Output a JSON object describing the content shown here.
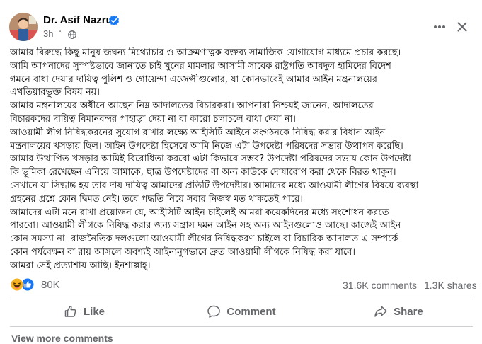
{
  "author": {
    "name": "Dr. Asif Nazrul",
    "time": "3h",
    "separator": "·",
    "verified": true,
    "verified_color": "#1877f2"
  },
  "post": {
    "lines": [
      "আমার বিরুদ্ধে কিছু মানুষ জঘন্য মিথ্যোচার ও আক্রমণাত্নক বক্তব্য সামাজিক যোগাযোগ মাধ্যমে প্রচার করছে।",
      "আমি আপনাদের সুস্পষ্টভাবে জানাতে চাই খুনের মামলার আসামী সাবেক রাষ্ট্রপতি আবদুল হামিদের বিদেশ",
      "গমনে বাধা দেয়ার দায়িত্ব পুলিশ ও গোয়েন্দা এজেন্সীগুলোর, যা কোনভাবেই আমার আইন মন্ত্রনালয়ের",
      "এখতিয়ারভুক্ত বিষয় নয়।",
      "আমার মন্ত্রনালয়ের অধীনে আছেন নিম্ন আদালতের বিচারকরা। আপনারা নিশ্চয়ই জানেন, আদালতের",
      "বিচারকদের দায়িত্ব বিমানবন্দর পাহাড়া দেয়া না বা কারো চলাচলে বাধা দেয়া না।",
      "আওয়ামী লীগ নিষিদ্ধকরনের সুযোগ রাখার লক্ষ্যে আইসিটি আইনে সংগঠনকে নিষিদ্ধ করার বিধান আইন",
      "মন্ত্রনালয়ের খসড়ায় ছিল। আইন উপদেষ্টা হিসেবে আমি নিজে এটা উপদেষ্টা পরিষদের সভায় উত্থাপন করেছি।",
      "আমার উত্থাপিত খসড়ার আমিই বিরোধিতা করবো এটা কিভাবে সম্ভব? উপদেষ্টা পরিষদের সভায় কোন উপদেষ্টা",
      "কি ভূমিকা রেখেছেন এনিয়ে আমাকে, ছাত্র উপদেষ্টাদের বা অন্য কাউকে দোষারোপ করা থেকে বিরত থাকুন।",
      "সেখানে যা সিদ্ধান্ত হয় তার দায় দায়িত্ব আমাদের প্রতিটি উপদেষ্টার। আমাদের মধ্যে আওয়ামী লীগের বিষয়ে ব্যবস্থা",
      "গ্রহনের প্রশ্নে কোন দ্বিমত নেই। তবে পদ্ধতি নিয়ে সবার নিজস্ব মত থাকতেই পারে।",
      "আমাদের এটা মনে রাখা প্রয়োজন যে, আইসিটি আইন চাইলেই আমরা কয়েকদিনের মধ্যে সংশোধন করতে",
      "পারবো। আওয়ামী লীগকে নিষিদ্ধ করার জন্য সন্ত্রাস দমন আইন সহ অন্য আইনগুলোও আছে। কাজেই আইন",
      "কোন সমস্যা না।  রাজনৈতিক দলগুলো আওয়ামী লীগের নিষিদ্ধকরণ চাইলে বা বিচারিক আদালত এ সম্পর্কে",
      "কোন পর্যবেক্ষন বা রায় আসলে অবশ্যই আইনানুগভাবে দ্রুত আওয়ামী লীগকে নিষিদ্ধ করা যাবে।",
      "আমরা সেই প্রত্যাশায় আছি। ইনশাল্লাহ্।"
    ]
  },
  "stats": {
    "reactions": "80K",
    "comments": "31.6K comments",
    "shares": "1.3K shares"
  },
  "actions": {
    "like": "Like",
    "comment": "Comment",
    "share": "Share"
  },
  "footer": {
    "more_comments": "View more comments"
  },
  "icons": {
    "more": "more-horizontal-icon",
    "close": "close-icon",
    "audience": "globe-icon",
    "reactions": [
      "haha-reaction-icon",
      "like-reaction-icon"
    ]
  },
  "colors": {
    "brand_blue": "#1877f2",
    "secondary_text": "#65676b",
    "divider": "#ced0d4",
    "haha_yellow": "#f7b125"
  }
}
